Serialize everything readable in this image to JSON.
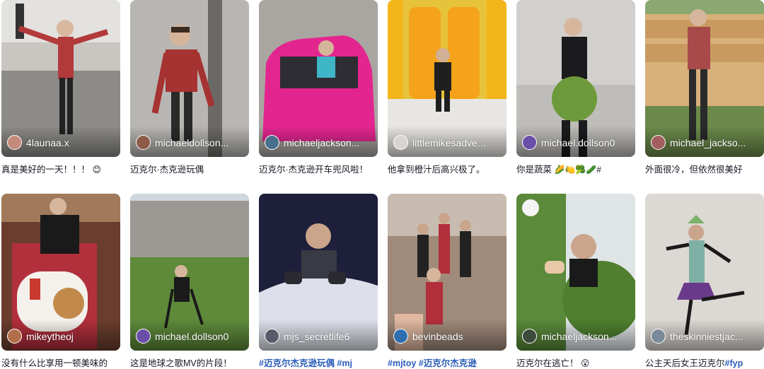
{
  "colors": {
    "hashtag": "#2b5db9",
    "caption_text": "#161823",
    "handle_text": "#ffffff"
  },
  "videos": [
    {
      "author": "4launaa.x",
      "caption": "真是美好的一天！！！",
      "emoji": "😊"
    },
    {
      "author": "michaeldollson...",
      "caption": "迈克尔·杰克逊玩偶"
    },
    {
      "author": "michaeljackson...",
      "caption": "迈克尔·杰克逊开车兜风啦！"
    },
    {
      "author": "littlemikesadve...",
      "caption": "他拿到橙汁后高兴极了。"
    },
    {
      "author": "michael.dollson0",
      "caption": "你是蔬菜",
      "emoji": "🌽🍋🥦🥒#"
    },
    {
      "author": "michael_jackso...",
      "caption": "外面很冷，但依然很美好"
    },
    {
      "author": "mikeytheoj",
      "caption": "没有什么比享用一顿美味的"
    },
    {
      "author": "michael.dollson0",
      "caption": "这是地球之歌MV的片段！"
    },
    {
      "author": "mjs_secretlife6",
      "caption_tags": "#迈克尔杰克逊玩偶 #mj"
    },
    {
      "author": "bevinbeads",
      "caption_tags": "#mjtoy #迈克尔杰克逊"
    },
    {
      "author": "michaeljackson...",
      "caption": "迈克尔在逃亡！",
      "emoji": "😮"
    },
    {
      "author": "theskinniestjac...",
      "caption": "公主天后女王迈克尔",
      "caption_tags": "#fyp"
    }
  ]
}
